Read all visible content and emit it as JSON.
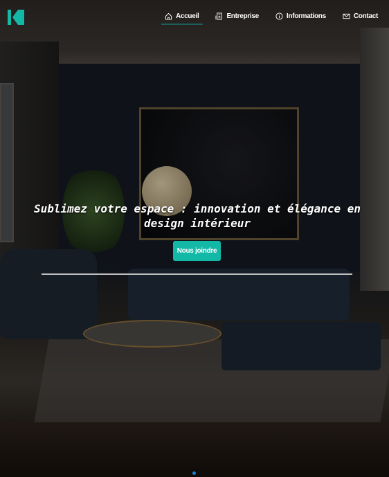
{
  "brand": {
    "accent": "#14b8a6",
    "logo_letter": "K"
  },
  "nav": {
    "items": [
      {
        "label": "Accueil",
        "icon": "home-icon",
        "active": true
      },
      {
        "label": "Entreprise",
        "icon": "building-icon",
        "active": false
      },
      {
        "label": "Informations",
        "icon": "info-icon",
        "active": false
      },
      {
        "label": "Contact",
        "icon": "mail-icon",
        "active": false
      }
    ]
  },
  "hero": {
    "title": "Sublimez votre espace : innovation et élégance en design intérieur",
    "cta_label": "Nous joindre"
  },
  "carousel": {
    "active_index": 0
  }
}
